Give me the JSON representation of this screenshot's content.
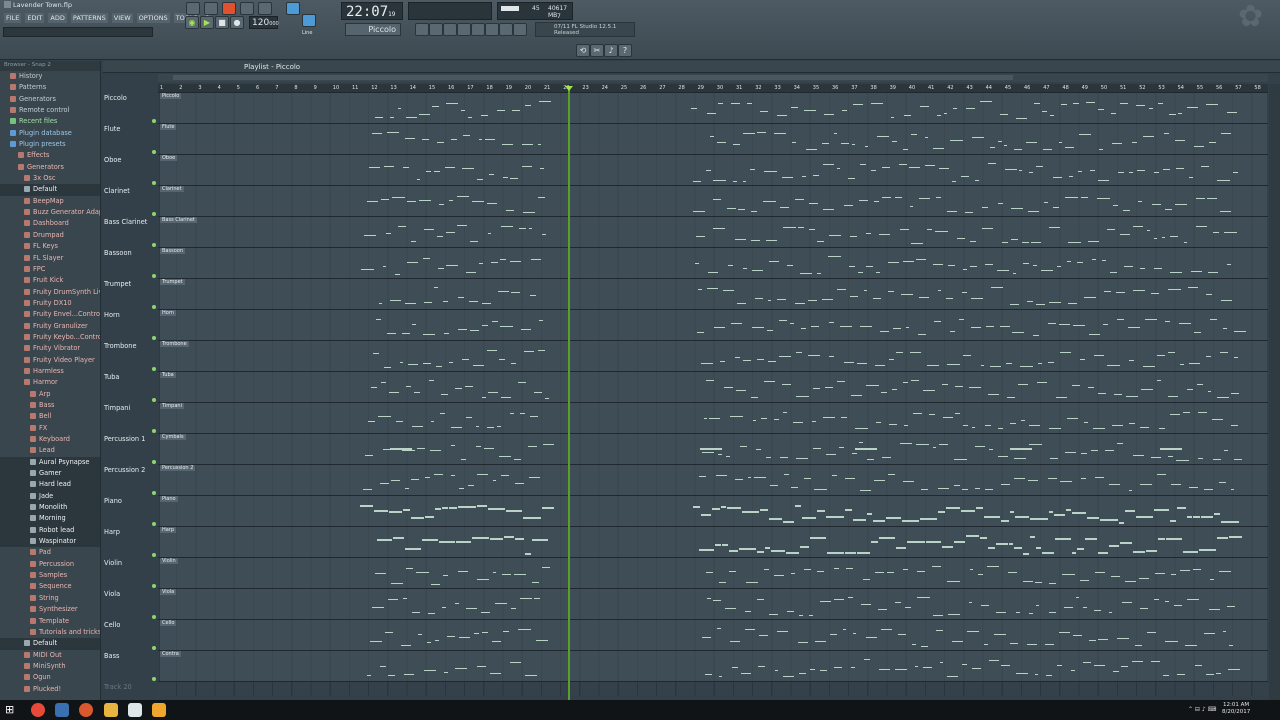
{
  "window": {
    "title": "Lavender Town.flp"
  },
  "menu": [
    "FILE",
    "EDIT",
    "ADD",
    "PATTERNS",
    "VIEW",
    "OPTIONS",
    "TOOLS",
    "?"
  ],
  "transport": {
    "time": "22:07",
    "time_sub": "19",
    "tempo": "120",
    "tempo_unit": "000",
    "pattern": "Piccolo",
    "mode": "Line"
  },
  "cpu": {
    "ram": "40617 MB",
    "cpu": "45",
    "poly": "7"
  },
  "news": {
    "text": "FL Studio 12.5.1",
    "status": "Released",
    "date": "07/11"
  },
  "browser": {
    "header": "Browser - Snap 2",
    "items": [
      {
        "label": "History",
        "level": 0,
        "color": "pink"
      },
      {
        "label": "Patterns",
        "level": 0,
        "color": "pink"
      },
      {
        "label": "Generators",
        "level": 0,
        "color": "pink"
      },
      {
        "label": "Remote control",
        "level": 0,
        "color": "pink"
      },
      {
        "label": "Recent files",
        "level": 0,
        "color": "green"
      },
      {
        "label": "Plugin database",
        "level": 0,
        "color": "blue"
      },
      {
        "label": "Plugin presets",
        "level": 0,
        "color": "blue"
      },
      {
        "label": "Effects",
        "level": 1,
        "color": "pink"
      },
      {
        "label": "Generators",
        "level": 1,
        "color": "pink"
      },
      {
        "label": "3x Osc",
        "level": 2,
        "color": "pink"
      },
      {
        "label": "Default",
        "level": 2,
        "color": "white"
      },
      {
        "label": "BeepMap",
        "level": 2,
        "color": "pink"
      },
      {
        "label": "Buzz Generator Adapter",
        "level": 2,
        "color": "pink"
      },
      {
        "label": "Dashboard",
        "level": 2,
        "color": "pink"
      },
      {
        "label": "Drumpad",
        "level": 2,
        "color": "pink"
      },
      {
        "label": "FL Keys",
        "level": 2,
        "color": "pink"
      },
      {
        "label": "FL Slayer",
        "level": 2,
        "color": "pink"
      },
      {
        "label": "FPC",
        "level": 2,
        "color": "pink"
      },
      {
        "label": "Fruit Kick",
        "level": 2,
        "color": "pink"
      },
      {
        "label": "Fruity DrumSynth Live",
        "level": 2,
        "color": "pink"
      },
      {
        "label": "Fruity DX10",
        "level": 2,
        "color": "pink"
      },
      {
        "label": "Fruity Envel...Controller",
        "level": 2,
        "color": "pink"
      },
      {
        "label": "Fruity Granulizer",
        "level": 2,
        "color": "pink"
      },
      {
        "label": "Fruity Keybo...Controller",
        "level": 2,
        "color": "pink"
      },
      {
        "label": "Fruity Vibrator",
        "level": 2,
        "color": "pink"
      },
      {
        "label": "Fruity Video Player",
        "level": 2,
        "color": "pink"
      },
      {
        "label": "Harmless",
        "level": 2,
        "color": "pink"
      },
      {
        "label": "Harmor",
        "level": 2,
        "color": "pink"
      },
      {
        "label": "Arp",
        "level": 3,
        "color": "pink"
      },
      {
        "label": "Bass",
        "level": 3,
        "color": "pink"
      },
      {
        "label": "Bell",
        "level": 3,
        "color": "pink"
      },
      {
        "label": "FX",
        "level": 3,
        "color": "pink"
      },
      {
        "label": "Keyboard",
        "level": 3,
        "color": "pink"
      },
      {
        "label": "Lead",
        "level": 3,
        "color": "pink"
      },
      {
        "label": "Aural Psynapse",
        "level": 3,
        "color": "white"
      },
      {
        "label": "Gamer",
        "level": 3,
        "color": "white"
      },
      {
        "label": "Hard lead",
        "level": 3,
        "color": "white"
      },
      {
        "label": "Jade",
        "level": 3,
        "color": "white"
      },
      {
        "label": "Monolith",
        "level": 3,
        "color": "white"
      },
      {
        "label": "Morning",
        "level": 3,
        "color": "white"
      },
      {
        "label": "Robot lead",
        "level": 3,
        "color": "white"
      },
      {
        "label": "Waspinator",
        "level": 3,
        "color": "white"
      },
      {
        "label": "Pad",
        "level": 3,
        "color": "pink"
      },
      {
        "label": "Percussion",
        "level": 3,
        "color": "pink"
      },
      {
        "label": "Samples",
        "level": 3,
        "color": "pink"
      },
      {
        "label": "Sequence",
        "level": 3,
        "color": "pink"
      },
      {
        "label": "String",
        "level": 3,
        "color": "pink"
      },
      {
        "label": "Synthesizer",
        "level": 3,
        "color": "pink"
      },
      {
        "label": "Template",
        "level": 3,
        "color": "pink"
      },
      {
        "label": "Tutorials and tricks",
        "level": 3,
        "color": "pink"
      },
      {
        "label": "Default",
        "level": 2,
        "color": "white"
      },
      {
        "label": "MIDI Out",
        "level": 2,
        "color": "pink"
      },
      {
        "label": "MiniSynth",
        "level": 2,
        "color": "pink"
      },
      {
        "label": "Ogun",
        "level": 2,
        "color": "pink"
      },
      {
        "label": "Plucked!",
        "level": 2,
        "color": "pink"
      }
    ]
  },
  "playlist": {
    "title": "Playlist - Piccolo",
    "ruler": [
      "1",
      "2",
      "3",
      "4",
      "5",
      "6",
      "7",
      "8",
      "9",
      "10",
      "11",
      "12",
      "13",
      "14",
      "15",
      "16",
      "17",
      "18",
      "19",
      "20",
      "21",
      "22",
      "23",
      "24",
      "25",
      "26",
      "27",
      "28",
      "29",
      "30",
      "31",
      "32",
      "33",
      "34",
      "35",
      "36",
      "37",
      "38",
      "39",
      "40",
      "41",
      "42",
      "43",
      "44",
      "45",
      "46",
      "47",
      "48",
      "49",
      "50",
      "51",
      "52",
      "53",
      "54",
      "55",
      "56",
      "57",
      "58"
    ],
    "tracks": [
      {
        "name": "Piccolo",
        "clip": "Piccolo"
      },
      {
        "name": "Flute",
        "clip": "Flute"
      },
      {
        "name": "Oboe",
        "clip": "Oboe"
      },
      {
        "name": "Clarinet",
        "clip": "Clarinet"
      },
      {
        "name": "Bass Clarinet",
        "clip": "Bass Clarinet"
      },
      {
        "name": "Bassoon",
        "clip": "Bassoon"
      },
      {
        "name": "Trumpet",
        "clip": "Trumpet"
      },
      {
        "name": "Horn",
        "clip": "Horn"
      },
      {
        "name": "Trombone",
        "clip": "Trombone"
      },
      {
        "name": "Tuba",
        "clip": "Tuba"
      },
      {
        "name": "Timpani",
        "clip": "Timpani"
      },
      {
        "name": "Percussion 1",
        "clip": "Cymbals"
      },
      {
        "name": "Percussion 2",
        "clip": "Percussion 2"
      },
      {
        "name": "Piano",
        "clip": "Piano"
      },
      {
        "name": "Harp",
        "clip": "Harp"
      },
      {
        "name": "Violin",
        "clip": "Violin"
      },
      {
        "name": "Viola",
        "clip": "Viola"
      },
      {
        "name": "Cello",
        "clip": "Cello"
      },
      {
        "name": "Bass",
        "clip": "Contra"
      },
      {
        "name": "Track 20",
        "clip": ""
      }
    ]
  },
  "taskbar": {
    "time": "12:01 AM",
    "date": "8/20/2017"
  },
  "colors": {
    "accent": "#a6e44e",
    "playhead": "#58a02a",
    "background": "#34414a"
  }
}
